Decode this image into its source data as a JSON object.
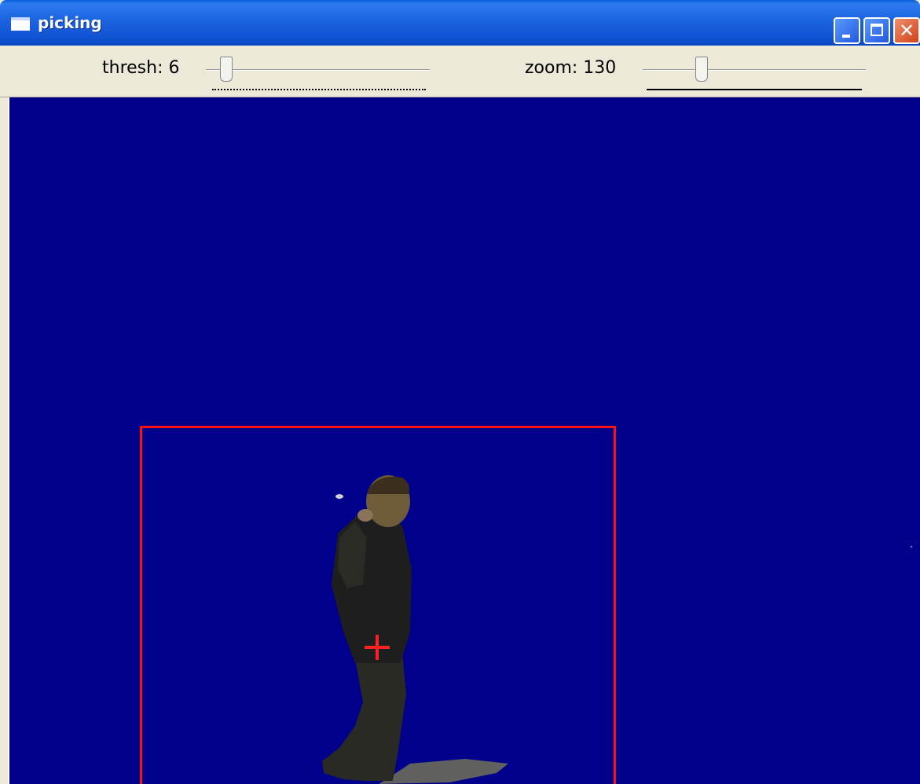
{
  "window": {
    "title": "picking",
    "buttons": {
      "close_glyph": "✕"
    }
  },
  "controls": {
    "thresh": {
      "label": "thresh: 6",
      "value": 6
    },
    "zoom": {
      "label": "zoom: 130",
      "value": 130
    }
  },
  "colors": {
    "background": "#00008b",
    "selection_box": "#ff1010",
    "crosshair": "#ff2020"
  }
}
